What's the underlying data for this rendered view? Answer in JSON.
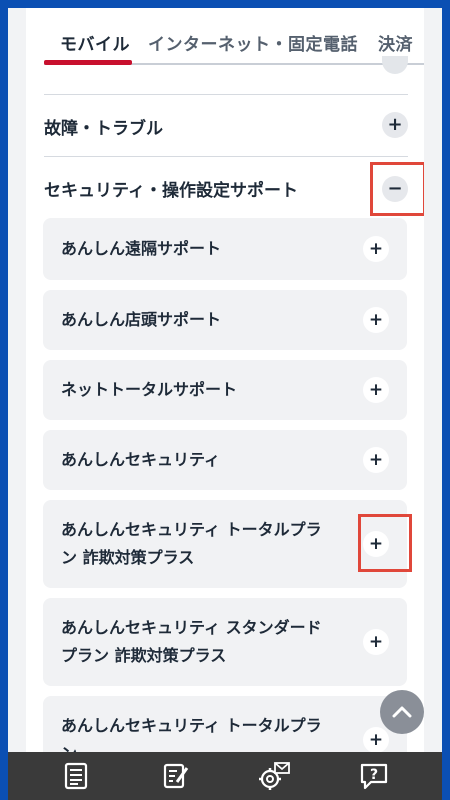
{
  "tabs": [
    {
      "label": "モバイル",
      "active": true
    },
    {
      "label": "インターネット・固定電話",
      "active": false
    },
    {
      "label": "決済",
      "active": false
    }
  ],
  "categories": {
    "trouble": {
      "label": "故障・トラブル",
      "icon": "plus-icon"
    },
    "security": {
      "label": "セキュリティ・操作設定サポート",
      "icon": "minus-icon"
    }
  },
  "items": [
    {
      "line1": "あんしん遠隔サポート"
    },
    {
      "line1": "あんしん店頭サポート"
    },
    {
      "line1": "ネットトータルサポート"
    },
    {
      "line1": "あんしんセキュリティ"
    },
    {
      "line1": "あんしんセキュリティ トータルプラ",
      "line2": "ン 詐欺対策プラス"
    },
    {
      "line1": "あんしんセキュリティ スタンダード",
      "line2": "プラン 詐欺対策プラス"
    },
    {
      "line1": "あんしんセキュリティ トータルプラ",
      "line2": "ン"
    }
  ],
  "colors": {
    "accent": "#c8102e",
    "highlight": "#e0473a",
    "frame": "#0b4fb3",
    "bottom_bar": "#3a3a3a"
  },
  "bottom_nav": [
    {
      "icon": "document-icon"
    },
    {
      "icon": "form-edit-icon"
    },
    {
      "icon": "settings-mail-icon"
    },
    {
      "icon": "help-chat-icon"
    }
  ]
}
